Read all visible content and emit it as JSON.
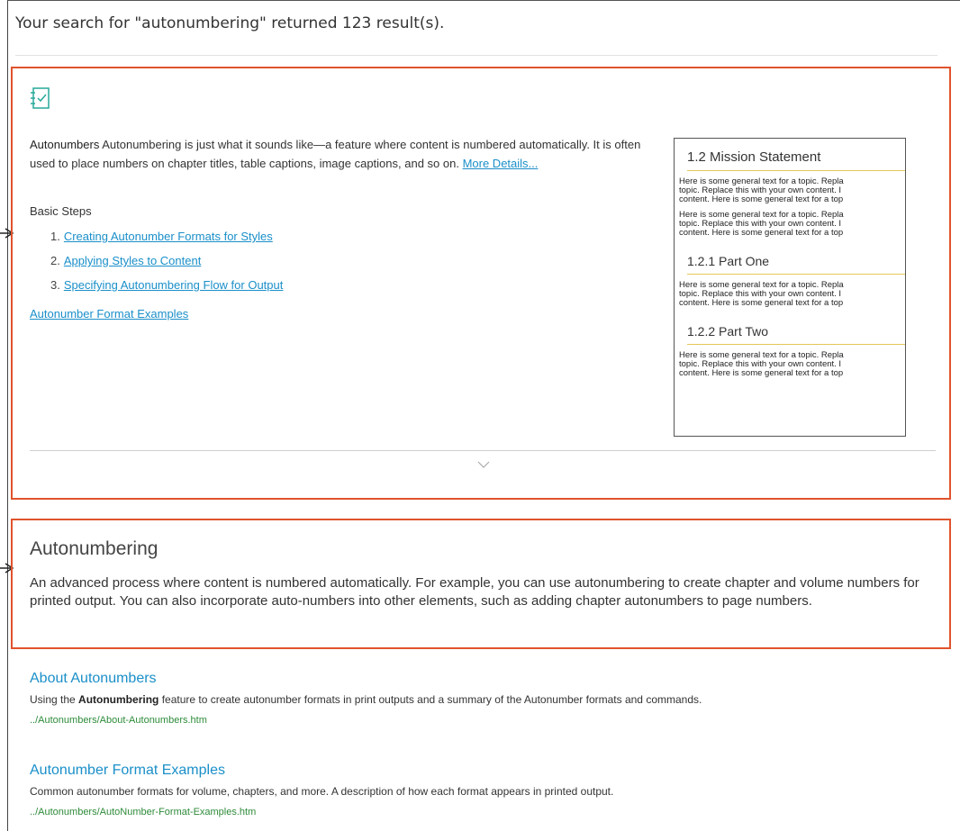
{
  "search": {
    "summary": "Your search for \"autonumbering\" returned 123 result(s)."
  },
  "micro_content": {
    "icon": "checklist-document-icon",
    "term": "Autonumbers",
    "description": " Autonumbering is just what it sounds like—a feature where content is numbered automatically. It is often used to place numbers on chapter titles, table captions, image captions, and so on. ",
    "more_details": "More Details...",
    "steps_heading": "Basic Steps",
    "steps": [
      {
        "num": "1.",
        "label": "Creating Autonumber Formats for Styles"
      },
      {
        "num": "2.",
        "label": "Applying Styles to Content"
      },
      {
        "num": "3.",
        "label": "Specifying Autonumbering Flow for Output"
      }
    ],
    "examples_link": "Autonumber Format Examples",
    "expand_icon": "chevron-down-icon",
    "preview": {
      "h1": "1.2   Mission Statement",
      "para_line1": "Here is some general text for a topic. Repla",
      "para_line2": "topic. Replace this with your own content. I",
      "para_line3": "content. Here is some general text for a top",
      "sub1": "1.2.1   Part One",
      "sub2": "1.2.2   Part Two"
    }
  },
  "glossary": {
    "term": "Autonumbering",
    "definition": "An advanced process where content is numbered automatically. For example, you can use autonumbering to create chapter and volume numbers for printed output. You can also incorporate auto-numbers into other elements, such as adding chapter autonumbers to page numbers."
  },
  "results": [
    {
      "title": "About Autonumbers",
      "desc_before": "Using the ",
      "desc_bold": "Autonumbering",
      "desc_after": " feature to create autonumber formats in print outputs and a summary of the Autonumber formats and commands.",
      "url": "../Autonumbers/About-Autonumbers.htm"
    },
    {
      "title": "Autonumber Format Examples",
      "desc": "Common autonumber formats for volume, chapters, and more. A description of how each format appears in printed output.",
      "url": "../Autonumbers/AutoNumber-Format-Examples.htm"
    }
  ],
  "colors": {
    "highlight_border": "#e0532d",
    "link": "#1a8fc9",
    "url": "#2e8b3a"
  }
}
